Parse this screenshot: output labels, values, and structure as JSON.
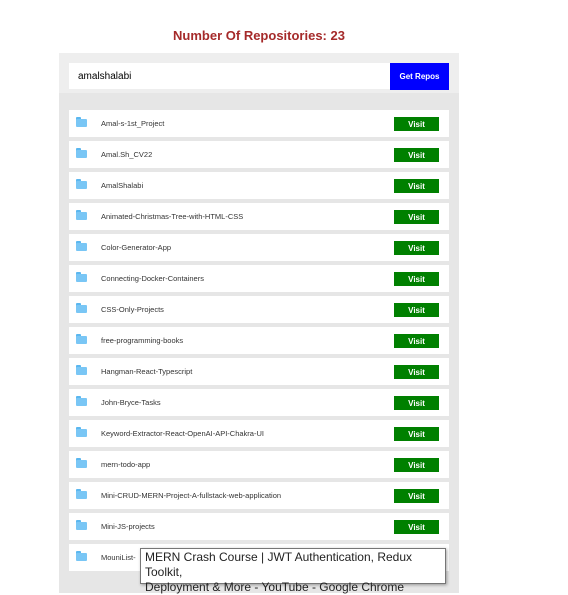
{
  "header": {
    "title": "Number Of Repositories: 23"
  },
  "search": {
    "value": "amalshalabi",
    "button_label": "Get Repos"
  },
  "repos": {
    "visit_label": "Visit",
    "items": [
      "Amal-s-1st_Project",
      "Amal.Sh_CV22",
      "AmalShalabi",
      "Animated-Christmas-Tree-with-HTML-CSS",
      "Color-Generator-App",
      "Connecting-Docker-Containers",
      "CSS-Only-Projects",
      "free-programming-books",
      "Hangman-React-Typescript",
      "John-Bryce-Tasks",
      "Keyword-Extractor-React-OpenAI-API-Chakra-UI",
      "mern-todo-app",
      "Mini-CRUD-MERN-Project-A-fullstack-web-application",
      "Mini-JS-projects",
      "MouniList-"
    ]
  },
  "tooltip": {
    "line1": "MERN Crash Course | JWT Authentication, Redux Toolkit,",
    "line2": "Deployment & More - YouTube - Google Chrome"
  },
  "colors": {
    "title": "#a52a2a",
    "get_button": "#0000ff",
    "visit_button": "#008000",
    "folder": "#79c6f5"
  },
  "icons": {
    "repo": "folder-icon"
  }
}
